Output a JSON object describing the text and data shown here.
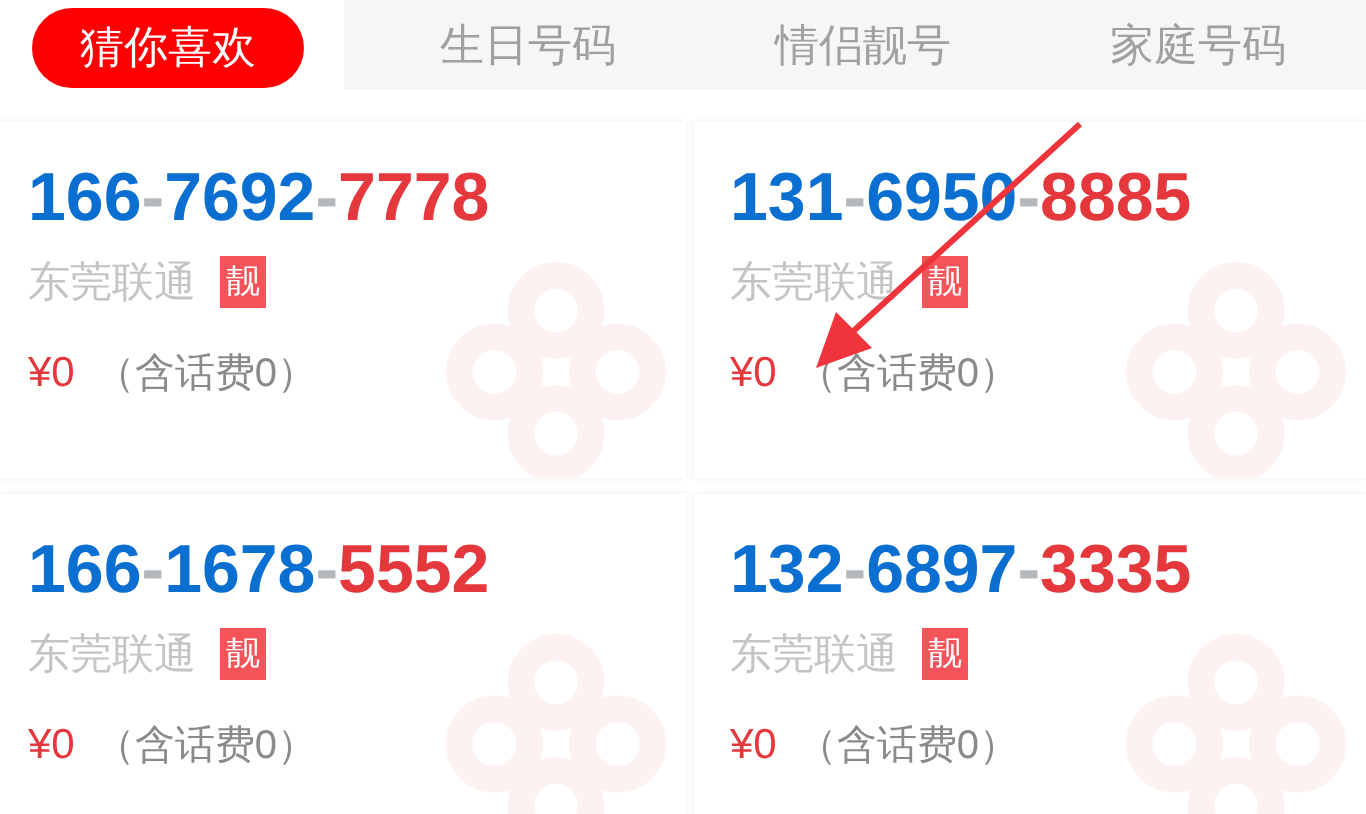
{
  "tabs": [
    {
      "label": "猜你喜欢",
      "selected": true
    },
    {
      "label": "生日号码",
      "selected": false
    },
    {
      "label": "情侣靓号",
      "selected": false
    },
    {
      "label": "家庭号码",
      "selected": false
    }
  ],
  "numbers": [
    {
      "parts": [
        {
          "text": "166",
          "kind": "main"
        },
        {
          "text": "-",
          "kind": "sep"
        },
        {
          "text": "7692",
          "kind": "main"
        },
        {
          "text": "-",
          "kind": "sep"
        },
        {
          "text": "7778",
          "kind": "tail"
        }
      ],
      "place": "东莞联通",
      "badge": "靓",
      "price": "¥0",
      "note": "（含话费0）"
    },
    {
      "parts": [
        {
          "text": "131",
          "kind": "main"
        },
        {
          "text": "-",
          "kind": "sep"
        },
        {
          "text": "6950",
          "kind": "main"
        },
        {
          "text": "-",
          "kind": "sep"
        },
        {
          "text": "8885",
          "kind": "tail"
        }
      ],
      "place": "东莞联通",
      "badge": "靓",
      "price": "¥0",
      "note": "（含话费0）"
    },
    {
      "parts": [
        {
          "text": "166",
          "kind": "main"
        },
        {
          "text": "-",
          "kind": "sep"
        },
        {
          "text": "1678",
          "kind": "main"
        },
        {
          "text": "-",
          "kind": "sep"
        },
        {
          "text": "5552",
          "kind": "tail"
        }
      ],
      "place": "东莞联通",
      "badge": "靓",
      "price": "¥0",
      "note": "（含话费0）"
    },
    {
      "parts": [
        {
          "text": "132",
          "kind": "main"
        },
        {
          "text": "-",
          "kind": "sep"
        },
        {
          "text": "6897",
          "kind": "main"
        },
        {
          "text": "-",
          "kind": "sep"
        },
        {
          "text": "3335",
          "kind": "tail"
        }
      ],
      "place": "东莞联通",
      "badge": "靓",
      "price": "¥0",
      "note": "（含话费0）"
    }
  ],
  "overlay": {
    "kind": "arrow"
  }
}
